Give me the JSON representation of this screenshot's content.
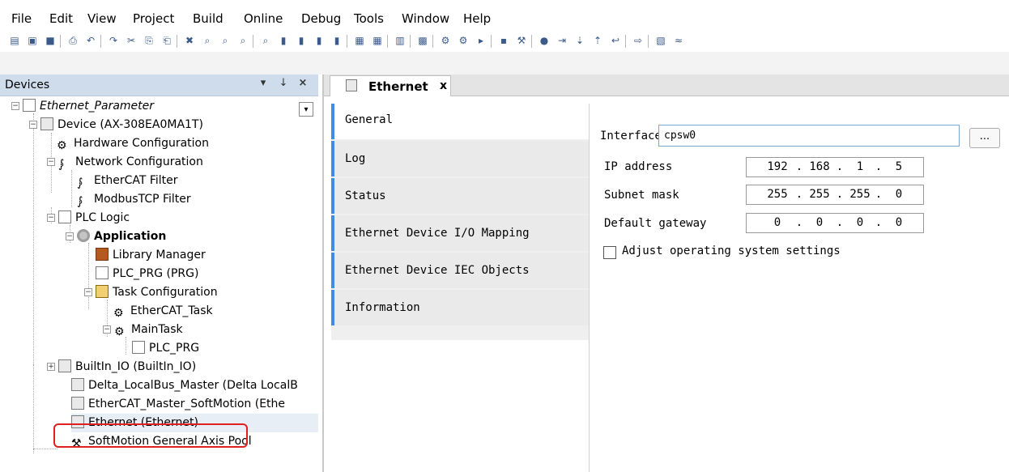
{
  "menu": {
    "items": [
      "File",
      "Edit",
      "View",
      "Project",
      "Build",
      "Online",
      "Debug",
      "Tools",
      "Window",
      "Help"
    ]
  },
  "toolbar": {
    "icons": [
      "new-project-icon",
      "open-icon",
      "save-icon",
      "print-icon",
      "undo-icon",
      "redo-icon",
      "cut-icon",
      "copy-icon",
      "paste-icon",
      "delete-icon",
      "find-icon",
      "find-next-icon",
      "find-previous-icon",
      "replace-icon",
      "bookmark-icon",
      "bookmark-next-icon",
      "bookmark-prev-icon",
      "bookmark-clear-icon",
      "device-icon",
      "add-device-icon",
      "insert-object-icon",
      "build-icon",
      "login-icon",
      "logout-icon",
      "start-icon",
      "stop-icon",
      "reset-icon",
      "breakpoint-icon",
      "step-over-icon",
      "step-into-icon",
      "step-out-icon",
      "step-return-icon",
      "run-to-cursor-icon",
      "write-values-icon",
      "force-values-icon"
    ]
  },
  "devices_panel": {
    "title": "Devices",
    "pin_label": "↓",
    "close_label": "×",
    "dropdown_label": "▾"
  },
  "tree": {
    "root": "Ethernet_Parameter",
    "device": "Device (AX-308EA0MA1T)",
    "hardware": "Hardware Configuration",
    "network": "Network Configuration",
    "ethercat_filter": "EtherCAT Filter",
    "modbus_filter": "ModbusTCP Filter",
    "plc_logic": "PLC Logic",
    "application": "Application",
    "library_manager": "Library Manager",
    "plc_prg": "PLC_PRG (PRG)",
    "task_config": "Task Configuration",
    "ethercat_task": "EtherCAT_Task",
    "main_task": "MainTask",
    "plc_prg_call": "PLC_PRG",
    "builtin_io": "BuiltIn_IO (BuiltIn_IO)",
    "localbus": "Delta_LocalBus_Master (Delta LocalB",
    "ethercat_master": "EtherCAT_Master_SoftMotion (Ethe",
    "ethernet": "Ethernet (Ethernet)",
    "axis_pool": "SoftMotion General Axis Pool"
  },
  "editor_tab": {
    "label": "Ethernet",
    "close": "x"
  },
  "side_tabs": [
    {
      "label": "General"
    },
    {
      "label": "Log"
    },
    {
      "label": "Status"
    },
    {
      "label": "Ethernet Device I/O Mapping"
    },
    {
      "label": "Ethernet Device IEC Objects"
    },
    {
      "label": "Information"
    }
  ],
  "general": {
    "interface_label": "Interface",
    "interface_value": "cpsw0",
    "browse_label": "...",
    "ip_label": "IP address",
    "ip": [
      "192",
      "168",
      "1",
      "5"
    ],
    "subnet_label": "Subnet mask",
    "subnet": [
      "255",
      "255",
      "255",
      "0"
    ],
    "gateway_label": "Default gateway",
    "gateway": [
      "0",
      "0",
      "0",
      "0"
    ],
    "adjust_label": "Adjust operating system settings",
    "adjust_checked": false
  },
  "colors": {
    "panel_header": "#cfdcec",
    "tab_accent": "#3a8ee6",
    "highlight_box": "#e02020"
  }
}
